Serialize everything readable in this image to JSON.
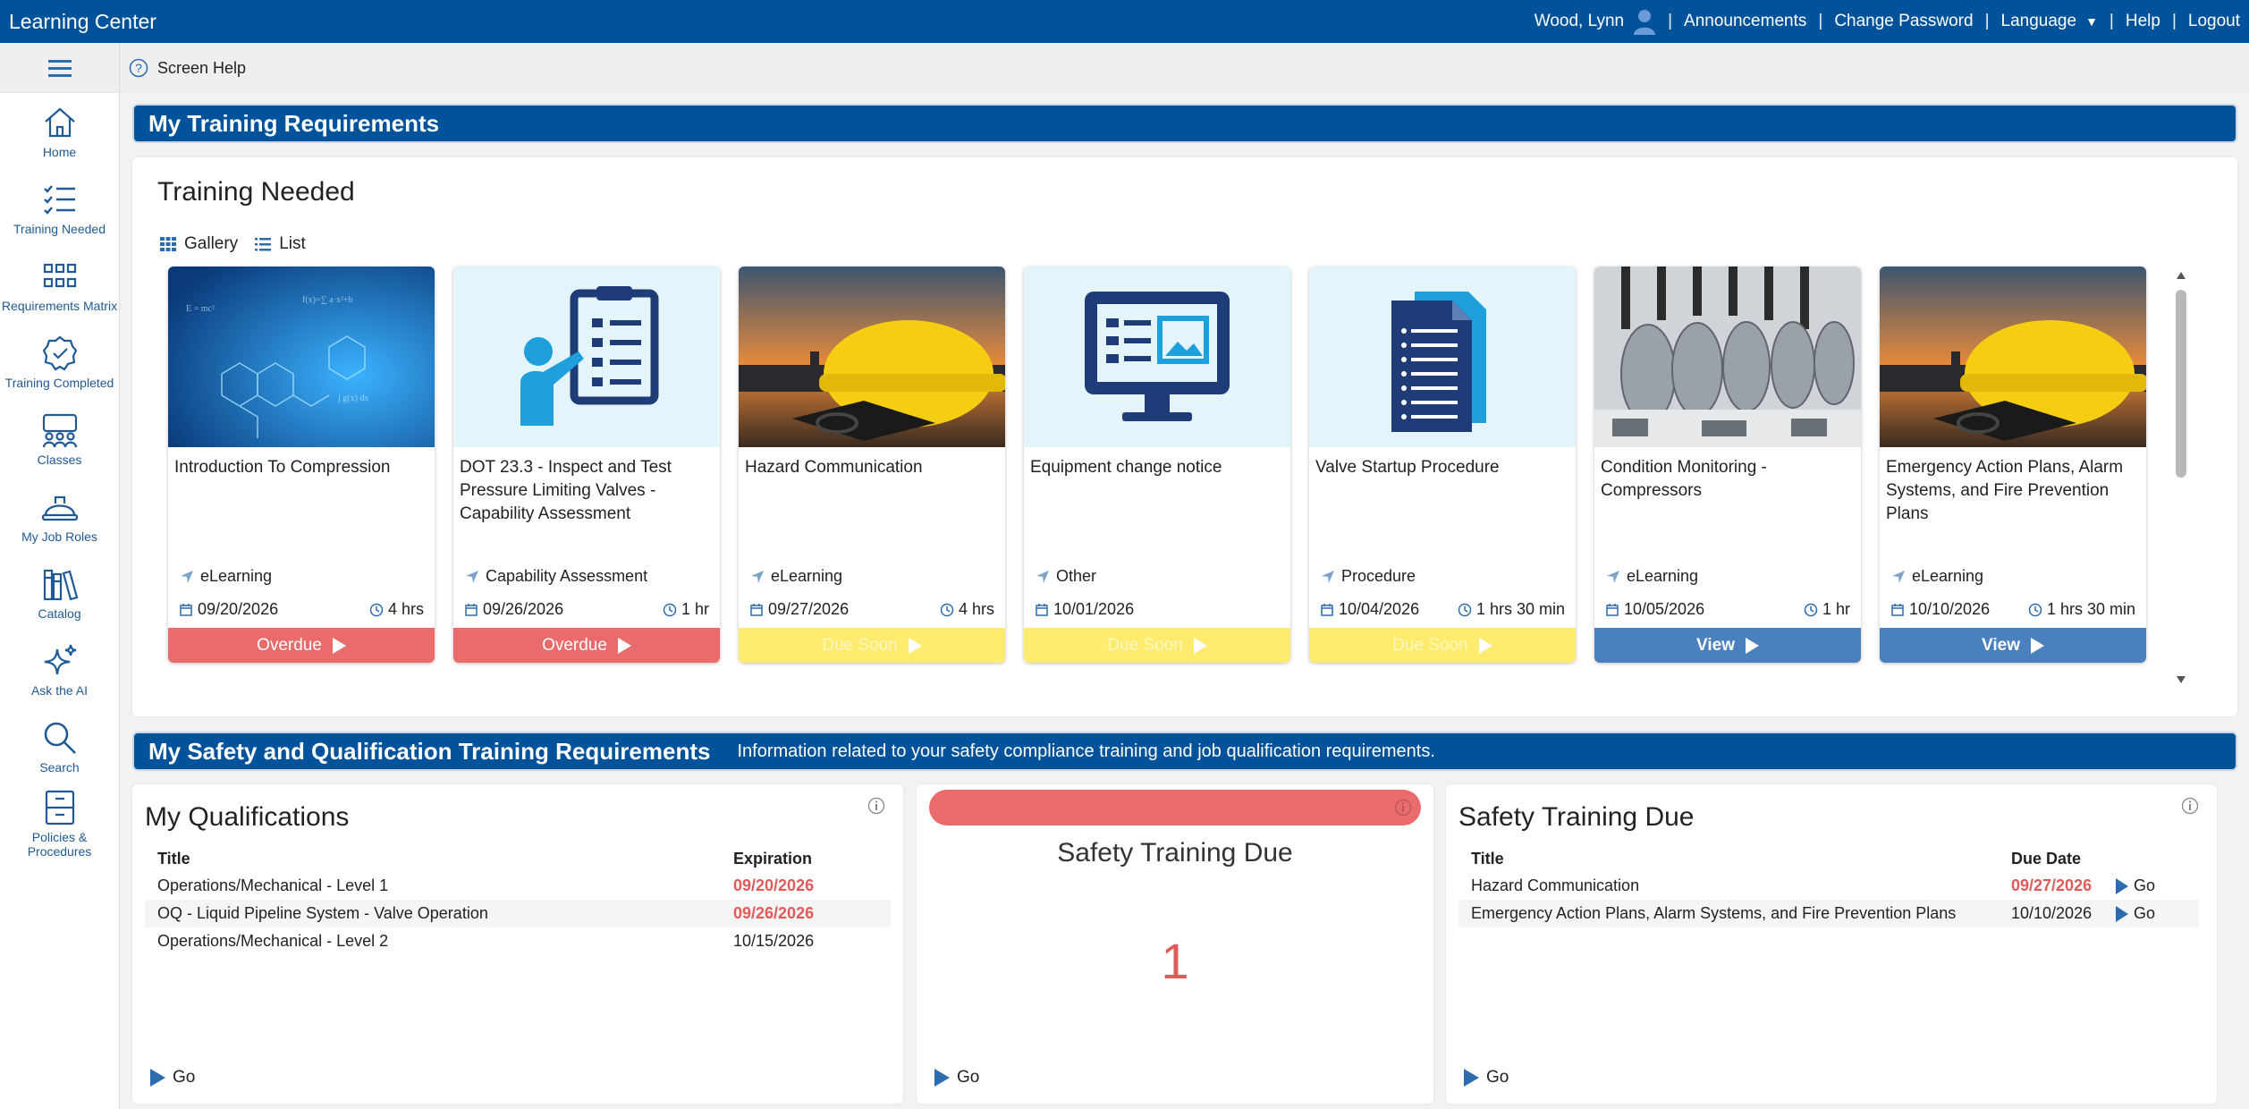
{
  "topbar": {
    "app_title": "Learning Center",
    "user_name": "Wood, Lynn",
    "links": [
      "Announcements",
      "Change Password",
      "Language",
      "Help",
      "Logout"
    ]
  },
  "sidebar": {
    "items": [
      {
        "label": "Home",
        "icon": "home-icon"
      },
      {
        "label": "Training Needed",
        "icon": "checklist-icon"
      },
      {
        "label": "Requirements Matrix",
        "icon": "grid-icon"
      },
      {
        "label": "Training Completed",
        "icon": "badge-check-icon"
      },
      {
        "label": "Classes",
        "icon": "classes-icon"
      },
      {
        "label": "My Job Roles",
        "icon": "hardhat-icon"
      },
      {
        "label": "Catalog",
        "icon": "books-icon"
      },
      {
        "label": "Ask the AI",
        "icon": "sparkle-icon"
      },
      {
        "label": "Search",
        "icon": "search-icon"
      },
      {
        "label": "Policies & Procedures",
        "icon": "cabinet-icon"
      }
    ]
  },
  "subheader": {
    "help_label": "Screen Help"
  },
  "training_section": {
    "band_title": "My Training Requirements",
    "panel_title": "Training Needed",
    "view_gallery": "Gallery",
    "view_list": "List",
    "cards": [
      {
        "title": "Introduction To Compression",
        "type": "eLearning",
        "date": "09/20/2026",
        "duration": "4 hrs",
        "status": "Overdue",
        "thumb": "molecule-image"
      },
      {
        "title": "DOT 23.3 - Inspect and Test Pressure Limiting Valves - Capability Assessment",
        "type": "Capability Assessment",
        "date": "09/26/2026",
        "duration": "1 hr",
        "status": "Overdue",
        "thumb": "presenter-icon"
      },
      {
        "title": "Hazard Communication",
        "type": "eLearning",
        "date": "09/27/2026",
        "duration": "4 hrs",
        "status": "Due Soon",
        "thumb": "hardhat-image"
      },
      {
        "title": "Equipment change notice",
        "type": "Other",
        "date": "10/01/2026",
        "duration": "",
        "status": "Due Soon",
        "thumb": "monitor-icon"
      },
      {
        "title": "Valve Startup Procedure",
        "type": "Procedure",
        "date": "10/04/2026",
        "duration": "1 hrs 30 min",
        "status": "Due Soon",
        "thumb": "document-icon"
      },
      {
        "title": "Condition Monitoring - Compressors",
        "type": "eLearning",
        "date": "10/05/2026",
        "duration": "1 hr",
        "status": "View",
        "thumb": "compressor-image"
      },
      {
        "title": "Emergency Action Plans, Alarm Systems, and Fire Prevention Plans",
        "type": "eLearning",
        "date": "10/10/2026",
        "duration": "1 hrs 30 min",
        "status": "View",
        "thumb": "hardhat-image"
      }
    ]
  },
  "safety_section": {
    "band_title": "My Safety and Qualification Training Requirements",
    "band_subtitle": "Information related to your safety compliance training and job qualification requirements."
  },
  "qualifications": {
    "title": "My Qualifications",
    "col_title": "Title",
    "col_exp": "Expiration",
    "rows": [
      {
        "title": "Operations/Mechanical - Level 1",
        "exp": "09/20/2026",
        "overdue": true
      },
      {
        "title": "OQ - Liquid Pipeline System - Valve Operation",
        "exp": "09/26/2026",
        "overdue": true
      },
      {
        "title": "Operations/Mechanical - Level 2",
        "exp": "10/15/2026",
        "overdue": false
      }
    ],
    "go": "Go"
  },
  "safety_due_count": {
    "title": "Safety Training Due",
    "count": "1",
    "go": "Go"
  },
  "safety_due": {
    "title": "Safety Training Due",
    "col_title": "Title",
    "col_due": "Due Date",
    "rows": [
      {
        "title": "Hazard Communication",
        "due": "09/27/2026",
        "overdue": true,
        "go": "Go"
      },
      {
        "title": "Emergency Action Plans, Alarm Systems, and Fire Prevention Plans",
        "due": "10/10/2026",
        "overdue": false,
        "go": "Go"
      }
    ],
    "go": "Go"
  },
  "colors": {
    "brand": "#00539b",
    "overdue": "#e96b6b",
    "due_soon": "#ffeb6e",
    "view": "#4a80bd"
  }
}
